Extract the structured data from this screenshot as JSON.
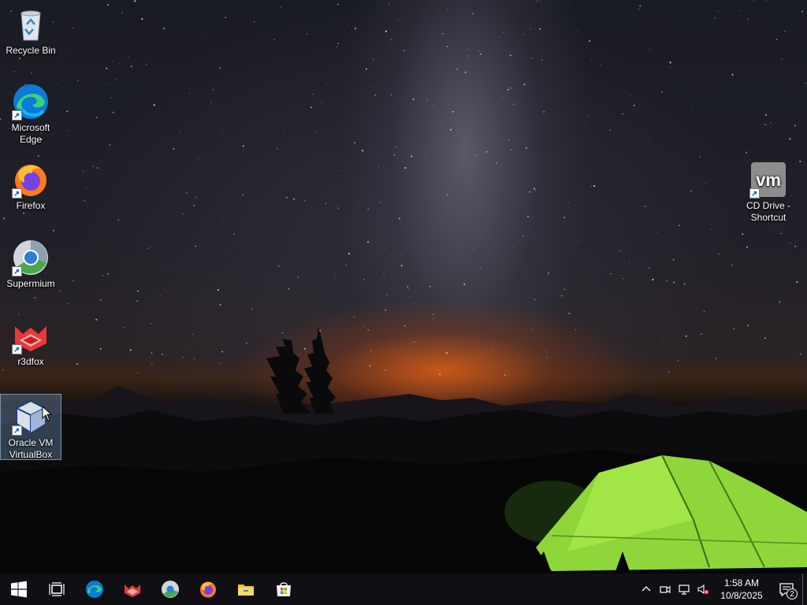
{
  "desktop": {
    "icons": [
      {
        "label": "Recycle Bin",
        "icon": "recycle-bin-icon"
      },
      {
        "label": "Microsoft Edge",
        "icon": "edge-icon"
      },
      {
        "label": "Firefox",
        "icon": "firefox-icon"
      },
      {
        "label": "Supermium",
        "icon": "supermium-icon"
      },
      {
        "label": "r3dfox",
        "icon": "r3dfox-icon"
      },
      {
        "label": "Oracle VM VirtualBox",
        "icon": "virtualbox-icon",
        "selected": true
      },
      {
        "label": "CD Drive - Shortcut",
        "icon": "vmware-cd-icon"
      }
    ]
  },
  "taskbar": {
    "buttons": [
      {
        "name": "start",
        "icon": "windows-logo-icon"
      },
      {
        "name": "task-view",
        "icon": "task-view-icon"
      },
      {
        "name": "edge",
        "icon": "edge-icon"
      },
      {
        "name": "r3dfox",
        "icon": "r3dfox-icon"
      },
      {
        "name": "supermium",
        "icon": "supermium-icon"
      },
      {
        "name": "firefox",
        "icon": "firefox-icon"
      },
      {
        "name": "file-explorer",
        "icon": "folder-icon"
      },
      {
        "name": "microsoft-store",
        "icon": "store-icon"
      }
    ],
    "tray": {
      "time": "1:58 AM",
      "date": "10/8/2025",
      "notification_count": "2",
      "icons": [
        "chevron-up-icon",
        "meet-now-icon",
        "network-icon",
        "volume-muted-icon"
      ]
    }
  },
  "colors": {
    "taskbar_bg": "#101014",
    "tent_green": "#8fd63a",
    "horizon_orange": "#e25f14",
    "selection_bg": "#6e8fb0"
  }
}
